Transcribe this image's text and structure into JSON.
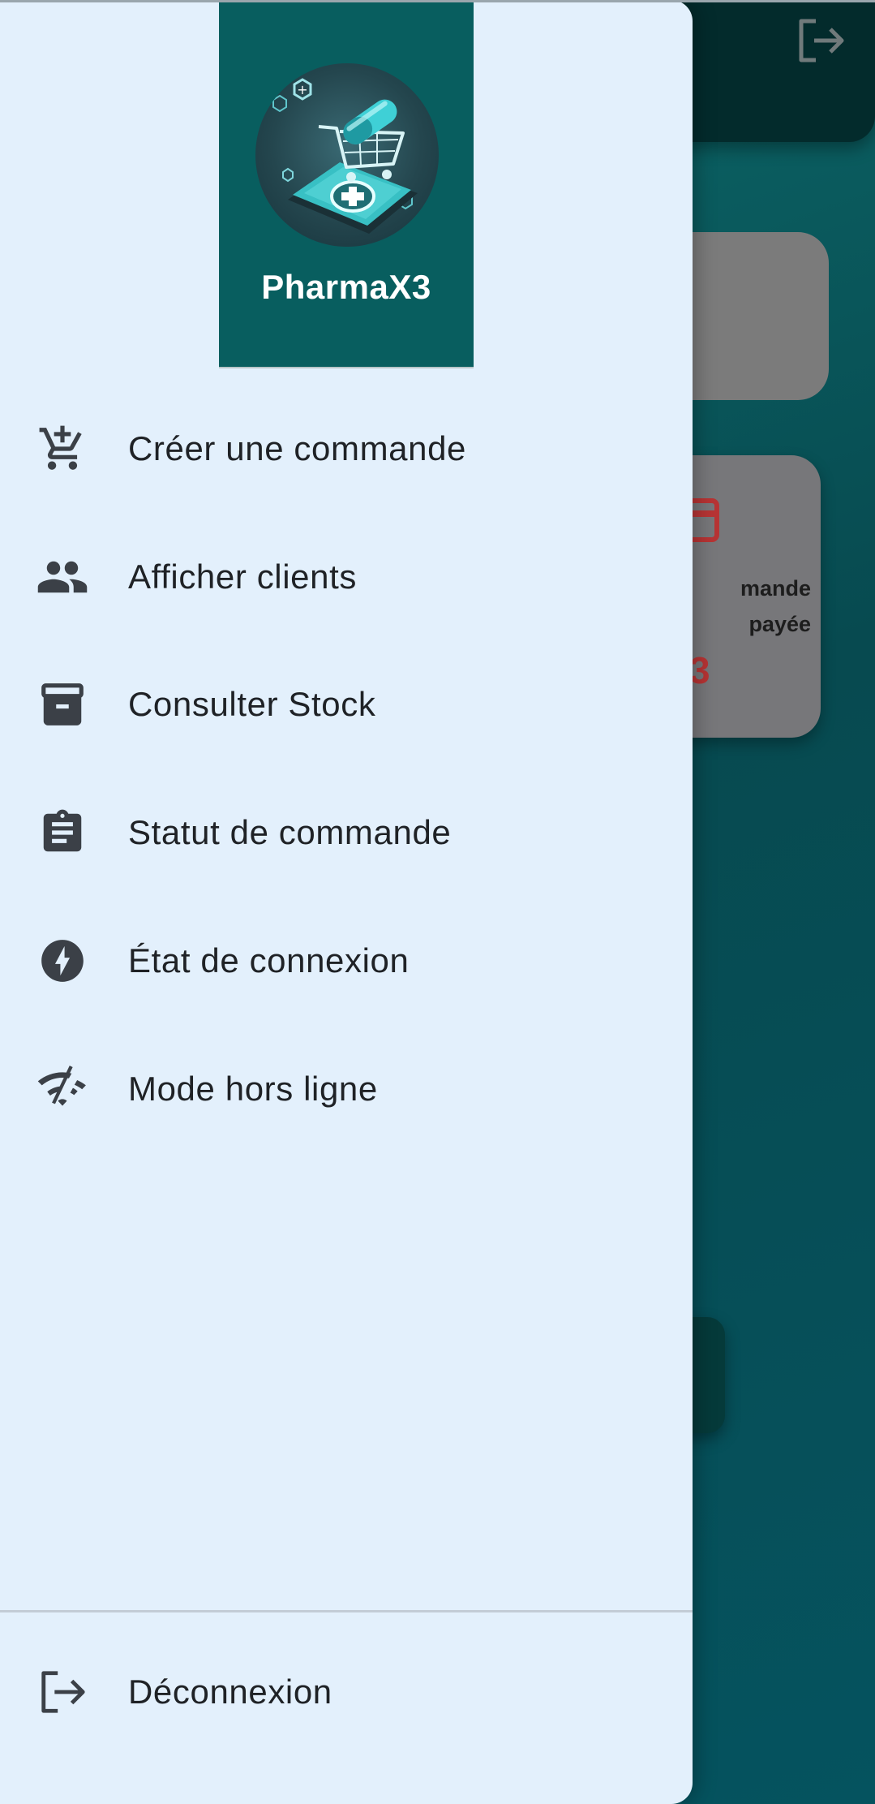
{
  "background": {
    "card_title": "mande\npayée",
    "card_count": "3",
    "colors": {
      "count": "#b73434",
      "drawer_bg": "#e3f0fc",
      "header_bg": "#085e5f"
    }
  },
  "drawer": {
    "brand": "PharmaX3",
    "logo_icon": "pharmacy-cart-phone-logo",
    "items": [
      {
        "label": "Créer une commande",
        "icon": "add-shopping-cart-icon"
      },
      {
        "label": "Afficher clients",
        "icon": "people-icon"
      },
      {
        "label": "Consulter Stock",
        "icon": "archive-box-icon"
      },
      {
        "label": "Statut de commande",
        "icon": "clipboard-icon"
      },
      {
        "label": "État de connexion",
        "icon": "lightning-icon"
      },
      {
        "label": "Mode hors ligne",
        "icon": "wifi-off-icon"
      }
    ],
    "logout": {
      "label": "Déconnexion",
      "icon": "logout-icon"
    }
  }
}
